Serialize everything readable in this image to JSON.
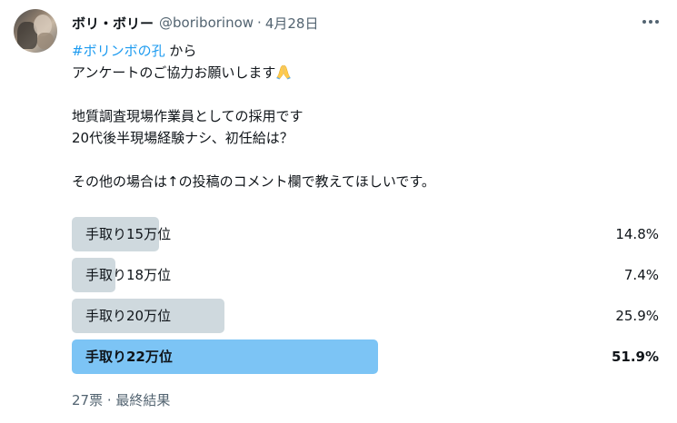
{
  "author": {
    "name": "ボリ・ボリー",
    "handle": "@boriborinow",
    "separator": "·",
    "date": "4月28日"
  },
  "tweet": {
    "hashtag": "#ボリンボの孔",
    "line1_suffix": " から",
    "line2": "アンケートのご協力お願いします",
    "emoji": "folded-hands",
    "line3": "地質調査現場作業員としての採用です",
    "line4": "20代後半現場経験ナシ、初任給は？",
    "line5": "その他の場合は↑の投稿のコメント欄で教えてほしいです。"
  },
  "poll": {
    "options": [
      {
        "label": "手取り15万位",
        "percent_text": "14.8%",
        "percent": 14.8,
        "winner": false
      },
      {
        "label": "手取り18万位",
        "percent_text": "7.4%",
        "percent": 7.4,
        "winner": false
      },
      {
        "label": "手取り20万位",
        "percent_text": "25.9%",
        "percent": 25.9,
        "winner": false
      },
      {
        "label": "手取り22万位",
        "percent_text": "51.9%",
        "percent": 51.9,
        "winner": true
      }
    ],
    "footer": "27票 · 最終結果"
  },
  "colors": {
    "hashtag": "#1d9bf0",
    "bar": "#cfd9de",
    "winner_bar": "#7cc4f5",
    "secondary_text": "#536471"
  }
}
